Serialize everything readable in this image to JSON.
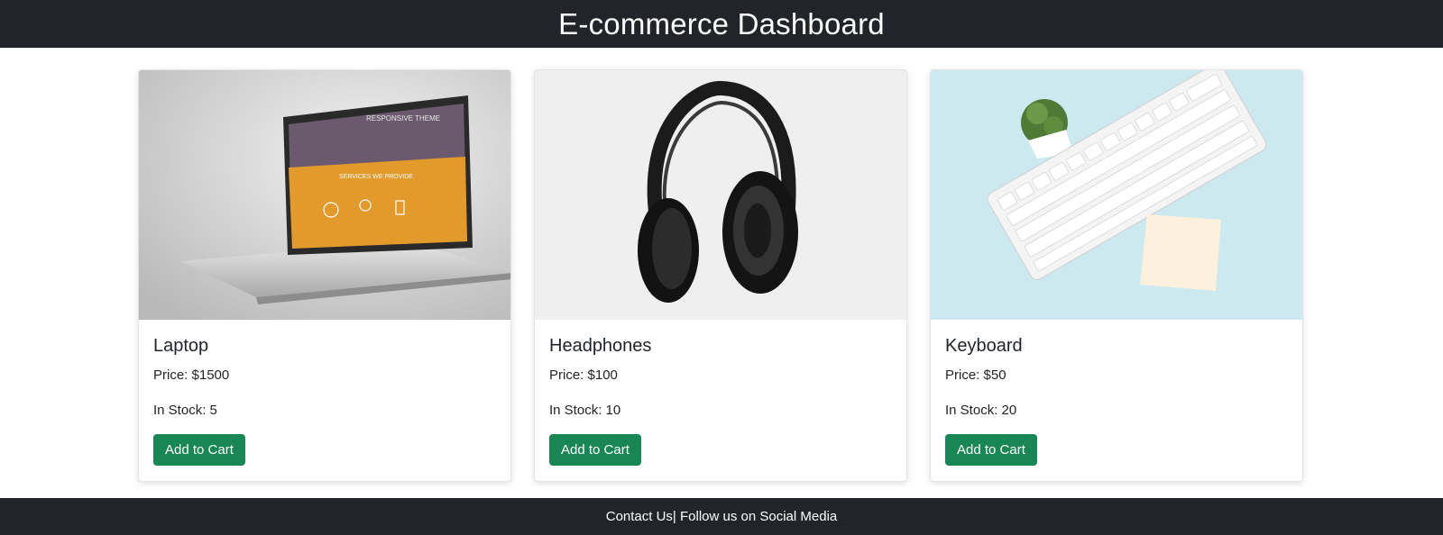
{
  "header": {
    "title": "E-commerce Dashboard"
  },
  "products": [
    {
      "name": "Laptop",
      "price": "Price: $1500",
      "stock": "In Stock: 5",
      "button_label": "Add to Cart",
      "image": {
        "screen_heading": "RESPONSIVE THEME",
        "screen_sub": "SERVICES WE PROVIDE"
      }
    },
    {
      "name": "Headphones",
      "price": "Price: $100",
      "stock": "In Stock: 10",
      "button_label": "Add to Cart"
    },
    {
      "name": "Keyboard",
      "price": "Price: $50",
      "stock": "In Stock: 20",
      "button_label": "Add to Cart"
    }
  ],
  "footer": {
    "text": "Contact Us| Follow us on Social Media"
  },
  "colors": {
    "header_bg": "#212529",
    "button_bg": "#198754",
    "keyboard_bg": "#cde9f0"
  }
}
